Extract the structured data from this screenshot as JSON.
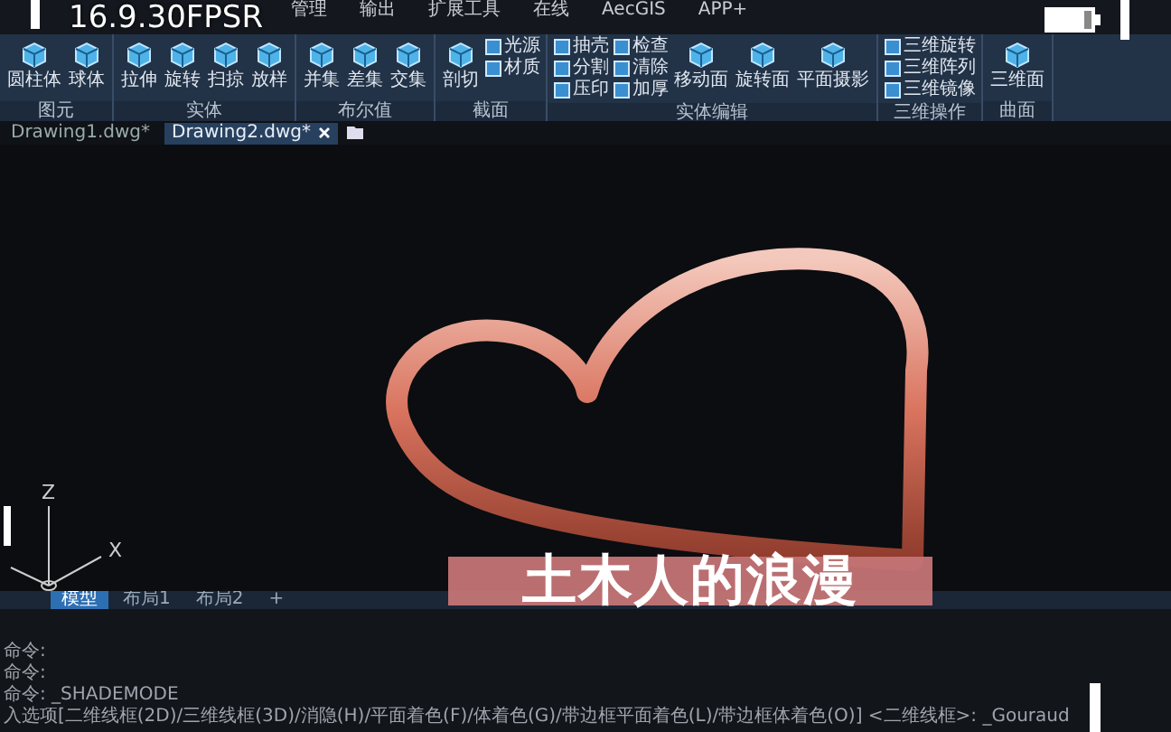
{
  "overlay": {
    "fps": "16.9.30FPSR"
  },
  "menu_tabs": [
    {
      "label": "管理",
      "selected": false
    },
    {
      "label": "输出",
      "selected": false
    },
    {
      "label": "扩展工具",
      "selected": false
    },
    {
      "label": "在线",
      "selected": false
    },
    {
      "label": "AecGIS",
      "selected": false
    },
    {
      "label": "APP+",
      "selected": false
    }
  ],
  "ribbon_panels": [
    {
      "title": "图元",
      "items": [
        {
          "kind": "large",
          "label": "圆柱体"
        },
        {
          "kind": "large",
          "label": "球体"
        }
      ]
    },
    {
      "title": "实体",
      "items": [
        {
          "kind": "large",
          "label": "拉伸"
        },
        {
          "kind": "large",
          "label": "旋转"
        },
        {
          "kind": "large",
          "label": "扫掠"
        },
        {
          "kind": "large",
          "label": "放样"
        }
      ]
    },
    {
      "title": "布尔值",
      "items": [
        {
          "kind": "large",
          "label": "并集"
        },
        {
          "kind": "large",
          "label": "差集"
        },
        {
          "kind": "large",
          "label": "交集"
        }
      ]
    },
    {
      "title": "截面",
      "items": [
        {
          "kind": "large",
          "label": "剖切"
        },
        {
          "kind": "stack",
          "labels": [
            "光源",
            "材质"
          ]
        }
      ]
    },
    {
      "title": "实体编辑",
      "items": [
        {
          "kind": "stack",
          "labels": [
            "抽壳",
            "分割",
            "压印"
          ]
        },
        {
          "kind": "stack",
          "labels": [
            "检查",
            "清除",
            "加厚"
          ]
        },
        {
          "kind": "large",
          "label": "移动面"
        },
        {
          "kind": "large",
          "label": "旋转面"
        },
        {
          "kind": "large",
          "label": "平面摄影"
        }
      ]
    },
    {
      "title": "三维操作",
      "items": [
        {
          "kind": "stack",
          "labels": [
            "三维旋转",
            "三维阵列",
            "三维镜像"
          ]
        }
      ]
    },
    {
      "title": "曲面",
      "items": [
        {
          "kind": "large",
          "label": "三维面"
        }
      ]
    }
  ],
  "file_tabs": [
    {
      "label": "Drawing1.dwg*",
      "selected": false
    },
    {
      "label": "Drawing2.dwg*",
      "selected": true
    }
  ],
  "axis_labels": [
    "Z",
    "X"
  ],
  "caption": "土木人的浪漫",
  "layout_tabs": [
    {
      "label": "模型",
      "selected": true
    },
    {
      "label": "布局1",
      "selected": false
    },
    {
      "label": "布局2",
      "selected": false
    },
    {
      "label": "+",
      "selected": false
    }
  ],
  "command_lines": [
    "命令:",
    "命令:",
    "命令: _SHADEMODE",
    "入选项[二维线框(2D)/三维线框(3D)/消隐(H)/平面着色(F)/体着色(G)/带边框平面着色(L)/带边框体着色(O)] <二维线框>: _Gouraud"
  ]
}
